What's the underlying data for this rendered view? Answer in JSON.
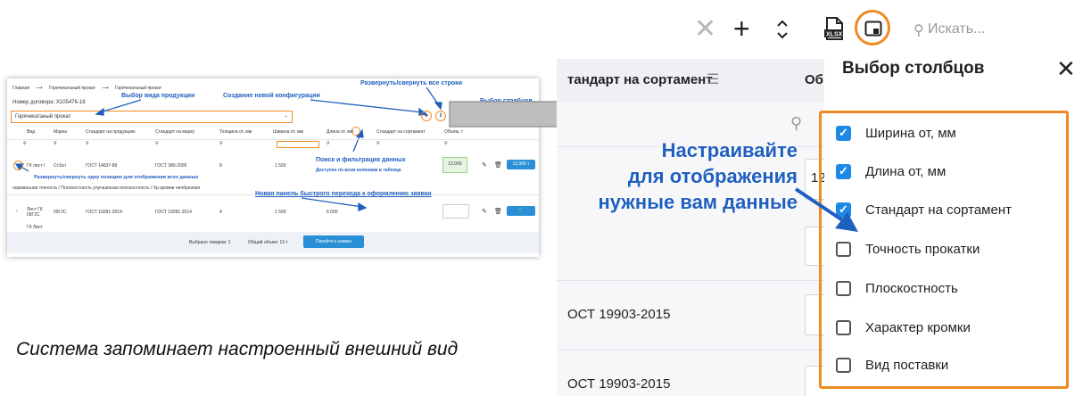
{
  "thumbnail": {
    "breadcrumb": [
      "Главная",
      "Горячекатаный прокат",
      "Горячекатаный прокат"
    ],
    "contract": "Номер договора: Х105476-18",
    "product_select": "Горячекатаный прокат",
    "headers": [
      "Вид",
      "Марка",
      "Стандарт на продукцию",
      "Стандарт на марку",
      "Толщина от, мм",
      "Ширина от, мм",
      "Длина от, мм",
      "Стандарт на сортамент",
      "Объем, т"
    ],
    "row1": {
      "kind": "ГК лист І",
      "grade": "Ст3сп",
      "std_product": "ГОСТ 14637-89",
      "std_grade": "ГОСТ 380-2005",
      "thickness": "8",
      "width": "1 500",
      "volume": "12,000",
      "btn": "12,000 т"
    },
    "row1_extra": "нормальная точность / Плоскостность улучшенная плоскостность / Хр кромки необрезная",
    "row2": {
      "kind": "Лист ГК 09Г2С",
      "grade": "09Г2С",
      "std_product": "ГОСТ 19281-2014",
      "std_grade": "ГОСТ 19281-2014",
      "thickness": "4",
      "width": "1 500",
      "length": "6 000"
    },
    "row3_kind": "ГК Лист",
    "footer": {
      "selected": "Выбрано товаров: 1",
      "total": "Общий объем: 12 т",
      "button": "Перейти к заявке"
    },
    "annotations": {
      "product_type": "Выбор вида продукции",
      "new_config": "Создание новой конфигурации",
      "expand_all": "Развернуть/свернуть все строки",
      "columns": "Выбор столбцов",
      "search": "Поиск и фильтрация данных",
      "search_sub": "Доступен по всем колонкам в таблице",
      "expand_one": "Развернуть/свернуть одну позицию для отображения всех данных",
      "quick_panel": "Новая панель быстрого перехода к оформлению заявки"
    }
  },
  "caption": "Система запоминает настроенный внешний вид",
  "callout": [
    "Настраивайте",
    "для отображения",
    "нужные вам данные"
  ],
  "right": {
    "toolbar": {
      "search_placeholder": "Искать..."
    },
    "table": {
      "header_col1": "тандарт на сортамент",
      "header_col2": "Об",
      "cell_partial": "12",
      "rows": [
        "ОСТ 19903-2015",
        "ОСТ 19903-2015"
      ]
    },
    "panel": {
      "title": "Выбор столбцов",
      "items": [
        {
          "label": "Ширина от, мм",
          "checked": true
        },
        {
          "label": "Длина от, мм",
          "checked": true
        },
        {
          "label": "Стандарт на сортамент",
          "checked": true
        },
        {
          "label": "Точность прокатки",
          "checked": false
        },
        {
          "label": "Плоскостность",
          "checked": false
        },
        {
          "label": "Характер кромки",
          "checked": false
        },
        {
          "label": "Вид поставки",
          "checked": false
        }
      ]
    }
  },
  "colors": {
    "accent_orange": "#f08a24",
    "accent_blue": "#1e88e5",
    "annotation_blue": "#1f5fbf"
  }
}
